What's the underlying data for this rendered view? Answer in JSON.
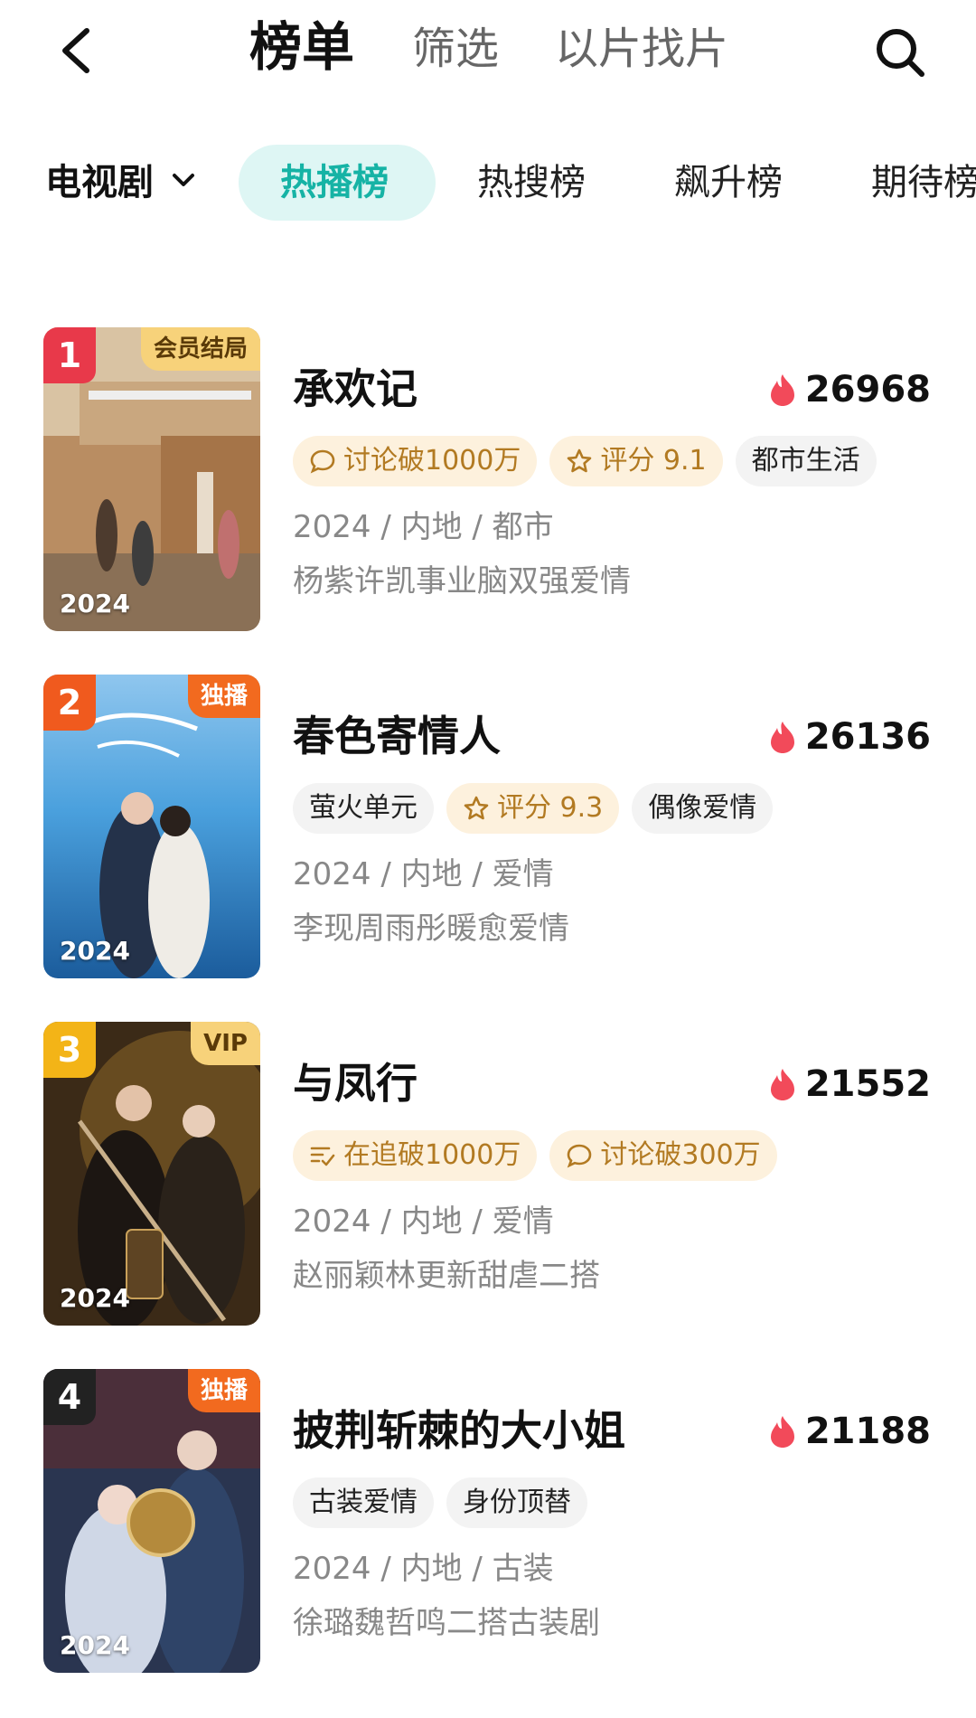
{
  "header": {
    "tabs": [
      "榜单",
      "筛选",
      "以片找片"
    ]
  },
  "filter": {
    "category": "电视剧",
    "rank_tabs": [
      "热播榜",
      "热搜榜",
      "飙升榜",
      "期待榜"
    ]
  },
  "items": [
    {
      "rank": "1",
      "corner": "会员结局",
      "year": "2024",
      "title": "承欢记",
      "heat": "26968",
      "tags": [
        {
          "icon": "comment-icon",
          "text": "讨论破1000万"
        },
        {
          "icon": "star-icon",
          "text": "评分 9.1"
        },
        {
          "text": "都市生活"
        }
      ],
      "meta": "2024 / 内地 / 都市",
      "desc": "杨紫许凯事业脑双强爱情"
    },
    {
      "rank": "2",
      "corner": "独播",
      "year": "2024",
      "title": "春色寄情人",
      "heat": "26136",
      "tags": [
        {
          "text": "萤火单元"
        },
        {
          "icon": "star-icon",
          "text": "评分 9.3"
        },
        {
          "text": "偶像爱情"
        }
      ],
      "meta": "2024 / 内地 / 爱情",
      "desc": "李现周雨彤暖愈爱情"
    },
    {
      "rank": "3",
      "corner": "VIP",
      "year": "2024",
      "title": "与凤行",
      "heat": "21552",
      "tags": [
        {
          "icon": "list-check-icon",
          "text": "在追破1000万"
        },
        {
          "icon": "comment-icon",
          "text": "讨论破300万"
        }
      ],
      "meta": "2024 / 内地 / 爱情",
      "desc": "赵丽颖林更新甜虐二搭"
    },
    {
      "rank": "4",
      "corner": "独播",
      "year": "2024",
      "title": "披荆斩棘的大小姐",
      "heat": "21188",
      "tags": [
        {
          "text": "古装爱情"
        },
        {
          "text": "身份顶替"
        }
      ],
      "meta": "2024 / 内地 / 古装",
      "desc": "徐璐魏哲鸣二搭古装剧"
    }
  ],
  "colors": {
    "accent": "#16b3a5",
    "rank1": "#e8394a",
    "rank2": "#f05a1e",
    "rank3": "#f3b417",
    "rank4": "#222222",
    "heat": "#f24a5a"
  }
}
